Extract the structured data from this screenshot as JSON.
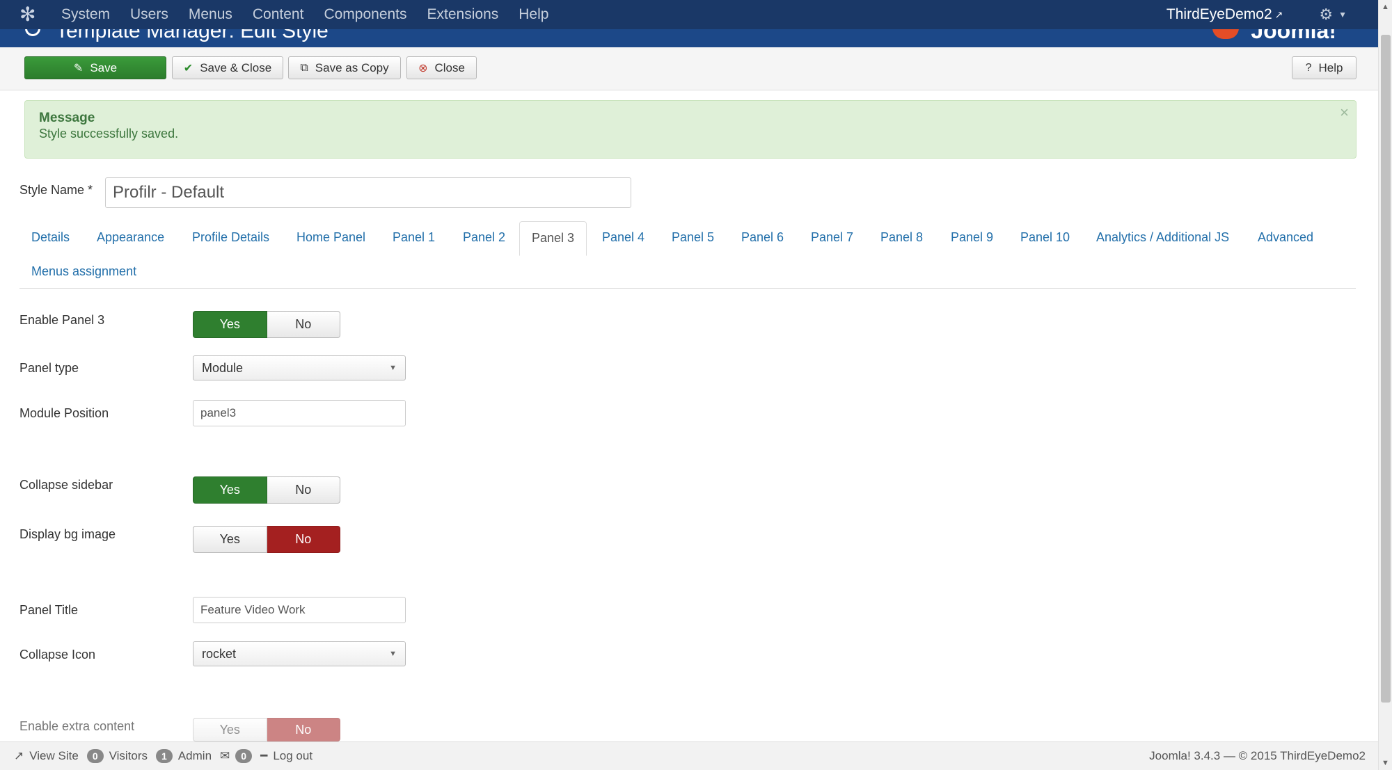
{
  "navbar": {
    "menu": [
      "System",
      "Users",
      "Menus",
      "Content",
      "Components",
      "Extensions",
      "Help"
    ],
    "site_name": "ThirdEyeDemo2"
  },
  "header": {
    "title": "Template Manager: Edit Style",
    "brand": "Joomla!"
  },
  "toolbar": {
    "save_label": "Save",
    "save_close_label": "Save & Close",
    "save_copy_label": "Save as Copy",
    "close_label": "Close",
    "help_label": "Help"
  },
  "alert": {
    "heading": "Message",
    "text": "Style successfully saved.",
    "close": "×"
  },
  "style_name": {
    "label": "Style Name *",
    "value": "Profilr - Default"
  },
  "tabs": {
    "details": "Details",
    "appearance": "Appearance",
    "profile_details": "Profile Details",
    "home_panel": "Home Panel",
    "panel1": "Panel 1",
    "panel2": "Panel 2",
    "panel3": "Panel 3",
    "panel4": "Panel 4",
    "panel5": "Panel 5",
    "panel6": "Panel 6",
    "panel7": "Panel 7",
    "panel8": "Panel 8",
    "panel9": "Panel 9",
    "panel10": "Panel 10",
    "analytics": "Analytics / Additional JS",
    "advanced": "Advanced",
    "menus_assignment": "Menus assignment",
    "active": "Panel 3"
  },
  "form": {
    "enable_panel3": {
      "label": "Enable Panel 3",
      "yes": "Yes",
      "no": "No",
      "value": "Yes"
    },
    "panel_type": {
      "label": "Panel type",
      "value": "Module"
    },
    "module_position": {
      "label": "Module Position",
      "value": "panel3"
    },
    "collapse_sidebar": {
      "label": "Collapse sidebar",
      "yes": "Yes",
      "no": "No",
      "value": "Yes"
    },
    "display_bg_image": {
      "label": "Display bg image",
      "yes": "Yes",
      "no": "No",
      "value": "No"
    },
    "panel_title": {
      "label": "Panel Title",
      "value": "Feature Video Work"
    },
    "collapse_icon": {
      "label": "Collapse Icon",
      "value": "rocket"
    },
    "enable_extra_content": {
      "label": "Enable extra content",
      "yes": "Yes",
      "no": "No",
      "value": "No"
    }
  },
  "footer": {
    "view_site": "View Site",
    "visitors_count": "0",
    "visitors_label": "Visitors",
    "admin_count": "1",
    "admin_label": "Admin",
    "messages_count": "0",
    "logout": "Log out",
    "copyright": "Joomla! 3.4.3  —  © 2015 ThirdEyeDemo2"
  }
}
